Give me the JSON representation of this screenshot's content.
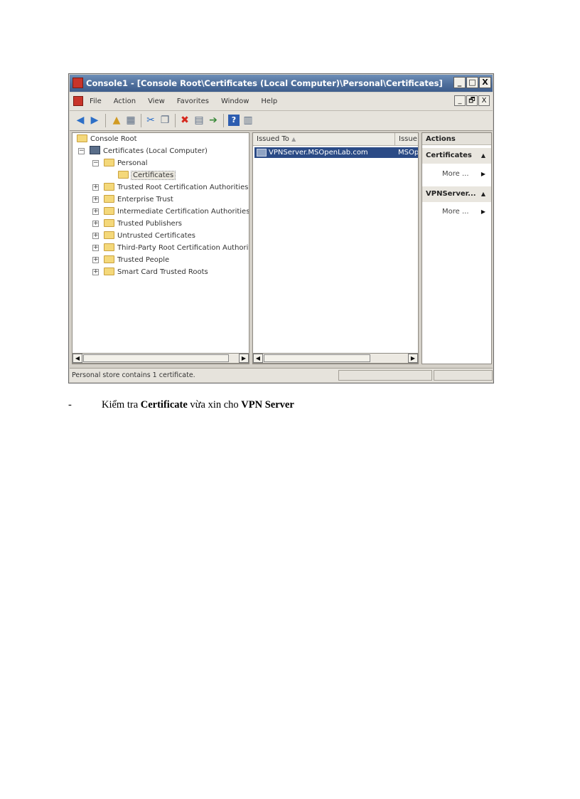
{
  "window": {
    "title": "Console1 - [Console Root\\Certificates (Local Computer)\\Personal\\Certificates]",
    "caption_buttons": [
      "_",
      "□",
      "X"
    ],
    "mdi_buttons": [
      "_",
      "🗗",
      "X"
    ]
  },
  "menu": [
    "File",
    "Action",
    "View",
    "Favorites",
    "Window",
    "Help"
  ],
  "tree": {
    "root": "Console Root",
    "computer": "Certificates (Local Computer)",
    "personal": "Personal",
    "certificates": "Certificates",
    "items": [
      "Trusted Root Certification Authorities",
      "Enterprise Trust",
      "Intermediate Certification Authorities",
      "Trusted Publishers",
      "Untrusted Certificates",
      "Third-Party Root Certification Authoriti",
      "Trusted People",
      "Smart Card Trusted Roots"
    ]
  },
  "list": {
    "col_issued_to": "Issued To",
    "col_issued_by": "Issue",
    "row_issued_to": "VPNServer.MSOpenLab.com",
    "row_issued_by": "MSOp"
  },
  "actions": {
    "header": "Actions",
    "section1": "Certificates",
    "section1_more": "More ...",
    "section2": "VPNServer...",
    "section2_more": "More ..."
  },
  "status": "Personal store contains 1 certificate.",
  "caption": {
    "dash": "-",
    "prefix": "Kiểm tra ",
    "bold1": "Certificate",
    "middle": " vừa xin cho ",
    "bold2": "VPN Server"
  },
  "colors": {
    "titlebar": "#4f6f9c",
    "selection": "#2b4b86",
    "folder": "#f4d87a"
  }
}
